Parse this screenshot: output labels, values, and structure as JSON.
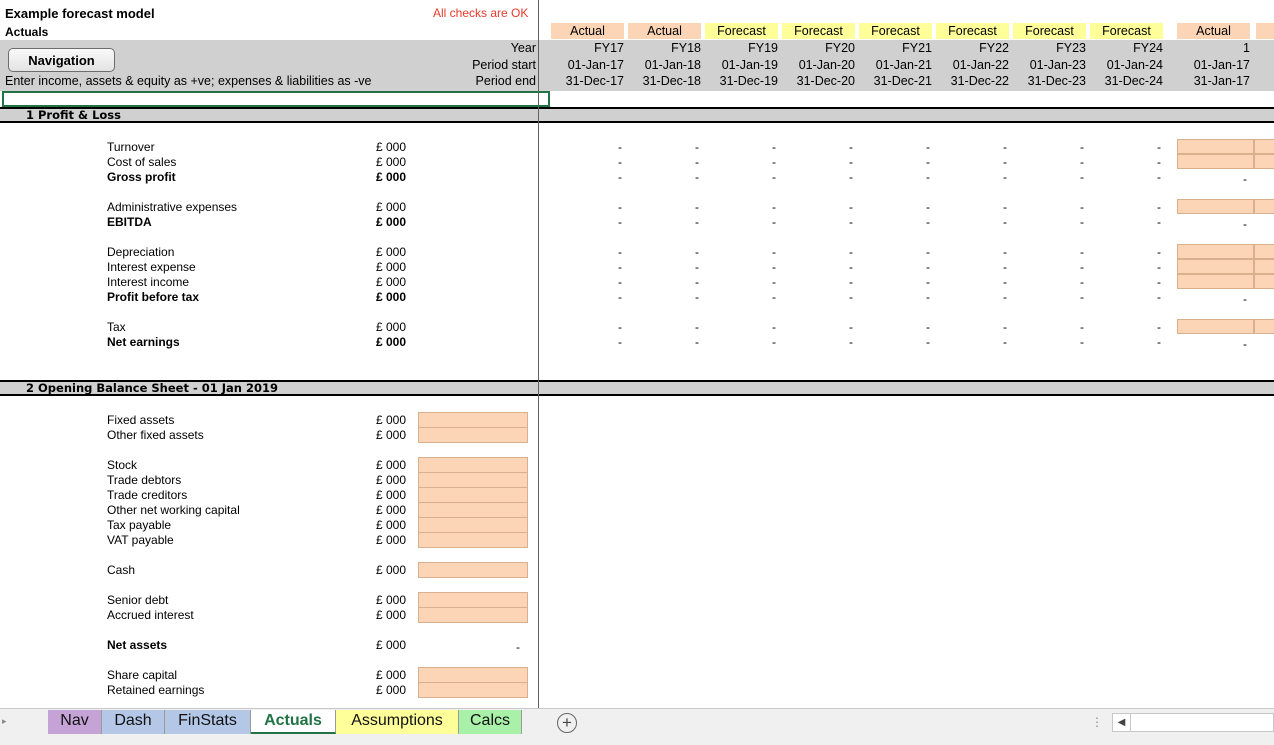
{
  "header": {
    "title": "Example forecast model",
    "subtitle": "Actuals",
    "checks_status": "All checks are OK",
    "nav_button": "Navigation",
    "instruction": "Enter income, assets & equity as +ve; expenses & liabilities as -ve",
    "row_labels": {
      "year": "Year",
      "period_start": "Period start",
      "period_end": "Period end"
    }
  },
  "columns": [
    {
      "type": "Actual",
      "year": "FY17",
      "start": "01-Jan-17",
      "end": "31-Dec-17"
    },
    {
      "type": "Actual",
      "year": "FY18",
      "start": "01-Jan-18",
      "end": "31-Dec-18"
    },
    {
      "type": "Forecast",
      "year": "FY19",
      "start": "01-Jan-19",
      "end": "31-Dec-19"
    },
    {
      "type": "Forecast",
      "year": "FY20",
      "start": "01-Jan-20",
      "end": "31-Dec-20"
    },
    {
      "type": "Forecast",
      "year": "FY21",
      "start": "01-Jan-21",
      "end": "31-Dec-21"
    },
    {
      "type": "Forecast",
      "year": "FY22",
      "start": "01-Jan-22",
      "end": "31-Dec-22"
    },
    {
      "type": "Forecast",
      "year": "FY23",
      "start": "01-Jan-23",
      "end": "31-Dec-23"
    },
    {
      "type": "Forecast",
      "year": "FY24",
      "start": "01-Jan-24",
      "end": "31-Dec-24"
    },
    {
      "type": "Actual",
      "year": "1",
      "start": "01-Jan-17",
      "end": "31-Jan-17"
    }
  ],
  "sections": {
    "pl_title": "1 Profit & Loss",
    "bs_title": "2 Opening Balance Sheet - 01 Jan 2019"
  },
  "pl_rows": [
    {
      "label": "Turnover",
      "unit": "£ 000",
      "bold": false,
      "input": true
    },
    {
      "label": "Cost of sales",
      "unit": "£ 000",
      "bold": false,
      "input": true
    },
    {
      "label": "Gross profit",
      "unit": "£ 000",
      "bold": true,
      "input": false
    },
    {
      "label": "Administrative expenses",
      "unit": "£ 000",
      "bold": false,
      "input": true
    },
    {
      "label": "EBITDA",
      "unit": "£ 000",
      "bold": true,
      "input": false
    },
    {
      "label": "Depreciation",
      "unit": "£ 000",
      "bold": false,
      "input": true
    },
    {
      "label": "Interest expense",
      "unit": "£ 000",
      "bold": false,
      "input": true
    },
    {
      "label": "Interest income",
      "unit": "£ 000",
      "bold": false,
      "input": true
    },
    {
      "label": "Profit before tax",
      "unit": "£ 000",
      "bold": true,
      "input": false
    },
    {
      "label": "Tax",
      "unit": "£ 000",
      "bold": false,
      "input": true
    },
    {
      "label": "Net earnings",
      "unit": "£ 000",
      "bold": true,
      "input": false
    }
  ],
  "bs_rows": [
    {
      "label": "Fixed assets",
      "unit": "£ 000",
      "bold": false,
      "input": true
    },
    {
      "label": "Other fixed assets",
      "unit": "£ 000",
      "bold": false,
      "input": true
    },
    {
      "label": "Stock",
      "unit": "£ 000",
      "bold": false,
      "input": true
    },
    {
      "label": "Trade debtors",
      "unit": "£ 000",
      "bold": false,
      "input": true
    },
    {
      "label": "Trade creditors",
      "unit": "£ 000",
      "bold": false,
      "input": true
    },
    {
      "label": "Other net working capital",
      "unit": "£ 000",
      "bold": false,
      "input": true
    },
    {
      "label": "Tax payable",
      "unit": "£ 000",
      "bold": false,
      "input": true
    },
    {
      "label": "VAT payable",
      "unit": "£ 000",
      "bold": false,
      "input": true
    },
    {
      "label": "Cash",
      "unit": "£ 000",
      "bold": false,
      "input": true
    },
    {
      "label": "Senior debt",
      "unit": "£ 000",
      "bold": false,
      "input": true
    },
    {
      "label": "Accrued interest",
      "unit": "£ 000",
      "bold": false,
      "input": true
    },
    {
      "label": "Net assets",
      "unit": "£ 000",
      "bold": true,
      "input": false,
      "value": "-"
    },
    {
      "label": "Share capital",
      "unit": "£ 000",
      "bold": false,
      "input": true
    },
    {
      "label": "Retained earnings",
      "unit": "£ 000",
      "bold": false,
      "input": true
    }
  ],
  "dash": "-",
  "tabs": [
    {
      "label": "Nav",
      "color": "#c5a3d6"
    },
    {
      "label": "Dash",
      "color": "#b4c7e7"
    },
    {
      "label": "FinStats",
      "color": "#b4c7e7"
    },
    {
      "label": "Actuals",
      "color": "#ffffff",
      "active": true
    },
    {
      "label": "Assumptions",
      "color": "#ffff99"
    },
    {
      "label": "Calcs",
      "color": "#a9f0a9"
    }
  ],
  "colors": {
    "actual_fill": "#fbd5b5",
    "forecast_fill": "#ffff99",
    "checks_ok": "#e8392b",
    "excel_green": "#217346"
  }
}
